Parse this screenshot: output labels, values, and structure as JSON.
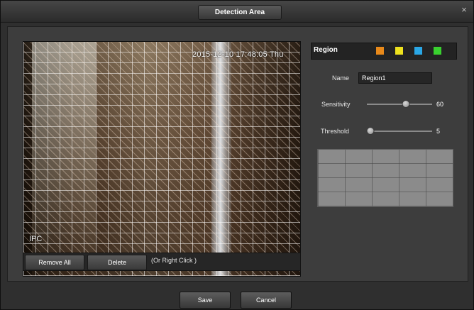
{
  "window": {
    "title": "Detection Area",
    "close_glyph": "×"
  },
  "video": {
    "timestamp": "2015-12-10 17:48:05 Thu",
    "camera_label": "IPC"
  },
  "actions": {
    "remove_all_label": "Remove All",
    "delete_label": "Delete",
    "hint": "(Or Right Click )"
  },
  "region": {
    "label": "Region",
    "colors": [
      "#e8891a",
      "#eee21e",
      "#2aa7e6",
      "#39d12f"
    ]
  },
  "name_field": {
    "label": "Name",
    "value": "Region1"
  },
  "sensitivity": {
    "label": "Sensitivity",
    "value": "60",
    "fraction": 0.6
  },
  "threshold": {
    "label": "Threshold",
    "value": "5",
    "fraction": 0.05
  },
  "footer": {
    "save_label": "Save",
    "cancel_label": "Cancel"
  }
}
